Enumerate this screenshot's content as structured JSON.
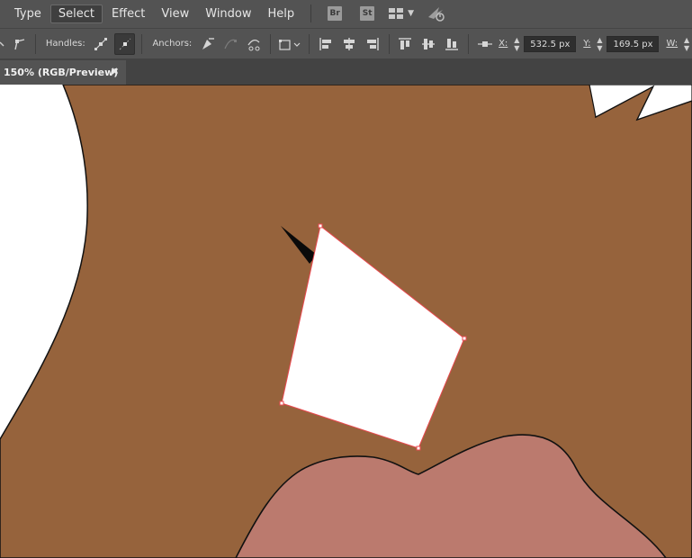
{
  "menubar": {
    "items": [
      "Type",
      "Select",
      "Effect",
      "View",
      "Window",
      "Help"
    ],
    "active_item": "Select",
    "bridge_label": "Br",
    "stock_label": "St"
  },
  "controlbar": {
    "handles_label": "Handles:",
    "anchors_label": "Anchors:",
    "x_label": "X:",
    "x_value": "532.5 px",
    "y_label": "Y:",
    "y_value": "169.5 px",
    "w_label": "W:"
  },
  "document_tab": {
    "title": "150% (RGB/Preview)",
    "close_glyph": "✖"
  },
  "canvas": {
    "skin_color": "#96633c",
    "lip_color": "#bb7a6e",
    "selection_color": "#e8484e",
    "fill_white": "#ffffff"
  }
}
